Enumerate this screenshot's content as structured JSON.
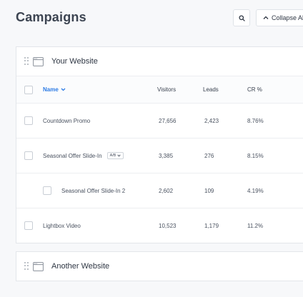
{
  "header": {
    "title": "Campaigns",
    "collapse_label": "Collapse All"
  },
  "websites": [
    {
      "name": "Your Website",
      "columns": {
        "name": "Name",
        "visitors": "Visitors",
        "leads": "Leads",
        "cr": "CR %"
      },
      "rows": [
        {
          "name": "Countdown Promo",
          "visitors": "27,656",
          "leads": "2,423",
          "cr": "8.76%"
        },
        {
          "name": "Seasonal Offer Slide-In",
          "badge": "A/B",
          "visitors": "3,385",
          "leads": "276",
          "cr": "8.15%"
        },
        {
          "name": "Seasonal Offer Slide-In 2",
          "visitors": "2,602",
          "leads": "109",
          "cr": "4.19%"
        },
        {
          "name": "Lightbox Video",
          "visitors": "10,523",
          "leads": "1,179",
          "cr": "11.2%"
        }
      ]
    },
    {
      "name": "Another Website"
    }
  ],
  "icons": {
    "search": "search-icon",
    "collapse": "chevron-up-icon",
    "sort": "chevron-down-icon",
    "drag": "drag-handle-icon",
    "site": "browser-window-icon"
  },
  "colors": {
    "accent": "#2c7be5",
    "title": "#3d4552",
    "background": "#f7f8fa"
  }
}
